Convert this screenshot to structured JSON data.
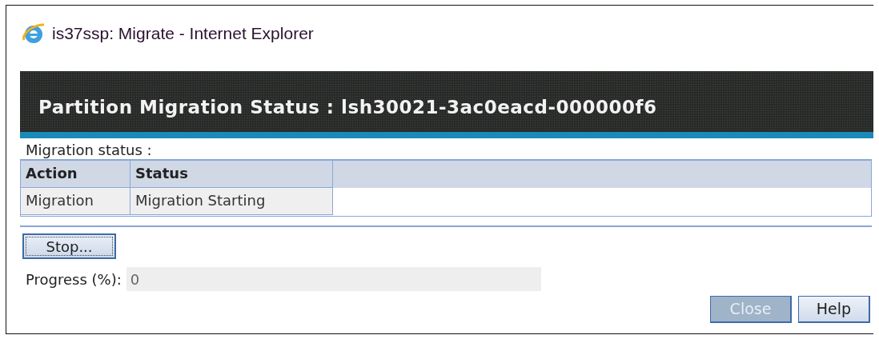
{
  "window": {
    "title": "is37ssp: Migrate - Internet Explorer"
  },
  "header": {
    "title": "Partition Migration Status : lsh30021-3ac0eacd-000000f6"
  },
  "section_label": "Migration status :",
  "table": {
    "columns": [
      "Action",
      "Status"
    ],
    "rows": [
      [
        "Migration",
        "Migration Starting"
      ]
    ]
  },
  "stop_button": {
    "label": "Stop...",
    "focused": true
  },
  "progress": {
    "label": "Progress (%):",
    "value": "0"
  },
  "buttons": [
    {
      "label": "Close",
      "disabled": true
    },
    {
      "label": "Help",
      "disabled": false
    }
  ]
}
